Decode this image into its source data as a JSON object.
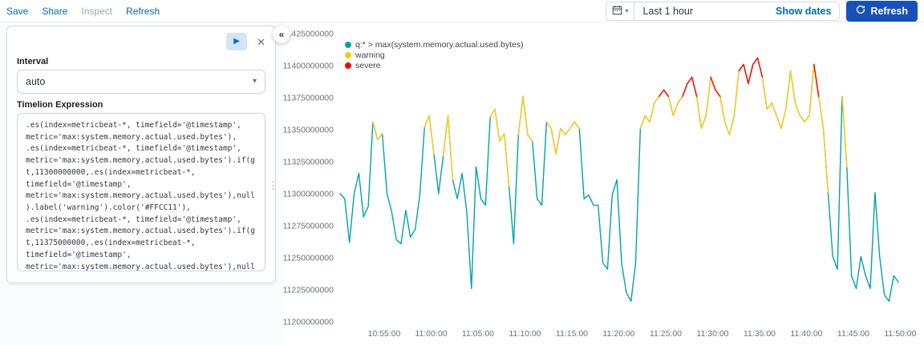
{
  "topbar": {
    "menu": [
      {
        "label": "Save"
      },
      {
        "label": "Share"
      },
      {
        "label": "Inspect"
      },
      {
        "label": "Refresh"
      }
    ],
    "time_range": "Last 1 hour",
    "show_dates_label": "Show dates",
    "refresh_button_label": "Refresh",
    "calendar_chevron_icon": "▾"
  },
  "editor": {
    "play_icon": "▶",
    "close_icon": "✕",
    "collapse_icon": "«",
    "drag_handle_icon": "⋮",
    "select_chevron_icon": "▾",
    "interval_label": "Interval",
    "interval_value": "auto",
    "expression_label": "Timelion Expression",
    "expression": ".es(index=metricbeat-*, timefield='@timestamp', metric='max:system.memory.actual.used.bytes'), .es(index=metricbeat-*, timefield='@timestamp', metric='max:system.memory.actual.used.bytes').if(gt,11300000000,.es(index=metricbeat-*, timefield='@timestamp', metric='max:system.memory.actual.used.bytes'),null).label('warning').color('#FFCC11'), .es(index=metricbeat-*, timefield='@timestamp', metric='max:system.memory.actual.used.bytes').if(gt,11375000000,.es(index=metricbeat-*, timefield='@timestamp', metric='max:system.memory.actual.used.bytes'),null).label('severe').color('red')"
  },
  "colors": {
    "link_blue": "#006BB4",
    "refresh_button": "#1750BA",
    "series_base": "#01A4A4",
    "series_warning": "#FFCC11",
    "series_severe": "#FF0000"
  },
  "chart_data": {
    "type": "line",
    "title": "",
    "xlabel": "",
    "ylabel": "",
    "grid": false,
    "legend_position": "top-left",
    "legend": [
      {
        "label": "q:* > max(system.memory.actual.used.bytes)",
        "color": "#01A4A4"
      },
      {
        "label": "warning",
        "color": "#FFCC11"
      },
      {
        "label": "severe",
        "color": "#FF0000"
      }
    ],
    "y_ticks": [
      11200000000,
      11225000000,
      11250000000,
      11275000000,
      11300000000,
      11325000000,
      11350000000,
      11375000000,
      11400000000,
      11425000000
    ],
    "ylim": [
      11200000000,
      11425000000
    ],
    "x_tick_labels": [
      "10:55:00",
      "11:00:00",
      "11:05:00",
      "11:10:00",
      "11:15:00",
      "11:20:00",
      "11:25:00",
      "11:30:00",
      "11:35:00",
      "11:40:00",
      "11:45:00",
      "11:50:00"
    ],
    "x_tick_positions": [
      5,
      10,
      15,
      20,
      25,
      30,
      35,
      40,
      45,
      50,
      55,
      60
    ],
    "x_unit": "minutes after 10:50:00",
    "xlim": [
      0.3,
      61.5
    ],
    "value_unit": "bytes",
    "value_multiplier": 1000000,
    "thresholds": [
      {
        "name": "warning",
        "gt": 11300000000,
        "color": "#FFCC11"
      },
      {
        "name": "severe",
        "gt": 11375000000,
        "color": "#FF0000"
      }
    ],
    "series": [
      {
        "name": "q:* > max(system.memory.actual.used.bytes)",
        "color": "#01A4A4",
        "x_start": 0.3,
        "x_step": 0.5,
        "values_millions": [
          11300,
          11296,
          11262,
          11300,
          11316,
          11282,
          11290,
          11356,
          11342,
          11347,
          11300,
          11286,
          11264,
          11261,
          11287,
          11266,
          11272,
          11299,
          11352,
          11361,
          11331,
          11300,
          11330,
          11361,
          11311,
          11296,
          11316,
          11286,
          11226,
          11321,
          11296,
          11291,
          11360,
          11366,
          11341,
          11347,
          11306,
          11261,
          11346,
          11376,
          11346,
          11341,
          11296,
          11291,
          11356,
          11351,
          11331,
          11351,
          11346,
          11351,
          11356,
          11351,
          11296,
          11299,
          11291,
          11291,
          11246,
          11241,
          11299,
          11311,
          11246,
          11223,
          11216,
          11246,
          11351,
          11361,
          11356,
          11371,
          11376,
          11381,
          11376,
          11361,
          11371,
          11376,
          11386,
          11391,
          11376,
          11351,
          11361,
          11391,
          11381,
          11376,
          11356,
          11346,
          11361,
          11396,
          11401,
          11386,
          11401,
          11406,
          11391,
          11366,
          11371,
          11361,
          11351,
          11366,
          11396,
          11371,
          11361,
          11356,
          11361,
          11401,
          11376,
          11351,
          11301,
          11251,
          11241,
          11376,
          11321,
          11236,
          11226,
          11251,
          11236,
          11226,
          11301,
          11251,
          11221,
          11216,
          11236,
          11231
        ]
      }
    ]
  }
}
